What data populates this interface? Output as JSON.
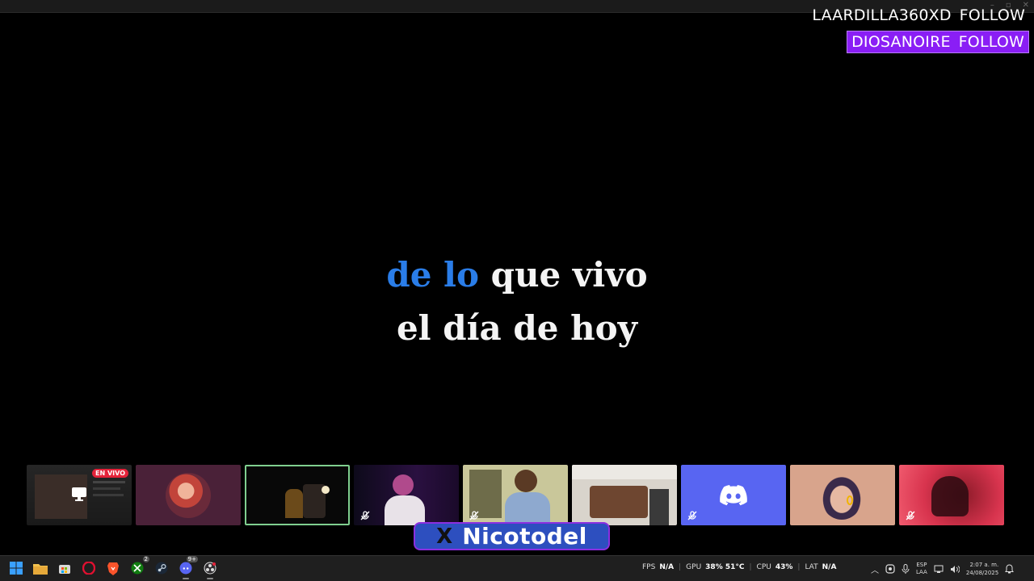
{
  "alerts": [
    {
      "name": "LAARDILLA360XD",
      "action": "FOLLOW"
    },
    {
      "name": "DIOSANOIRE",
      "action": "FOLLOW"
    }
  ],
  "lyrics": {
    "line1_sung": "de lo",
    "line1_rest": " que vivo",
    "line2": "el día de hoy"
  },
  "strip": {
    "live_badge": "EN VIVO"
  },
  "namebar": {
    "platform_symbol": "X",
    "handle": "Nicotodel"
  },
  "taskbar": {
    "xbox_badge": "2",
    "discord_badge": "9+",
    "fps_label": "FPS",
    "fps_value": "N/A",
    "gpu_label": "GPU",
    "gpu_value": "38% 51°C",
    "cpu_label": "CPU",
    "cpu_value": "43%",
    "lat_label": "LAT",
    "lat_value": "N/A",
    "lang_top": "ESP",
    "lang_bottom": "LAA",
    "time": "2:07 a. m.",
    "date": "24/08/2025"
  },
  "colors": {
    "sung": "#2a7de8",
    "alert_highlight": "#8a1ef5",
    "namebar_outer": "#8b2fe0",
    "namebar_inner": "#2d4fbf",
    "discord": "#5865f2"
  }
}
